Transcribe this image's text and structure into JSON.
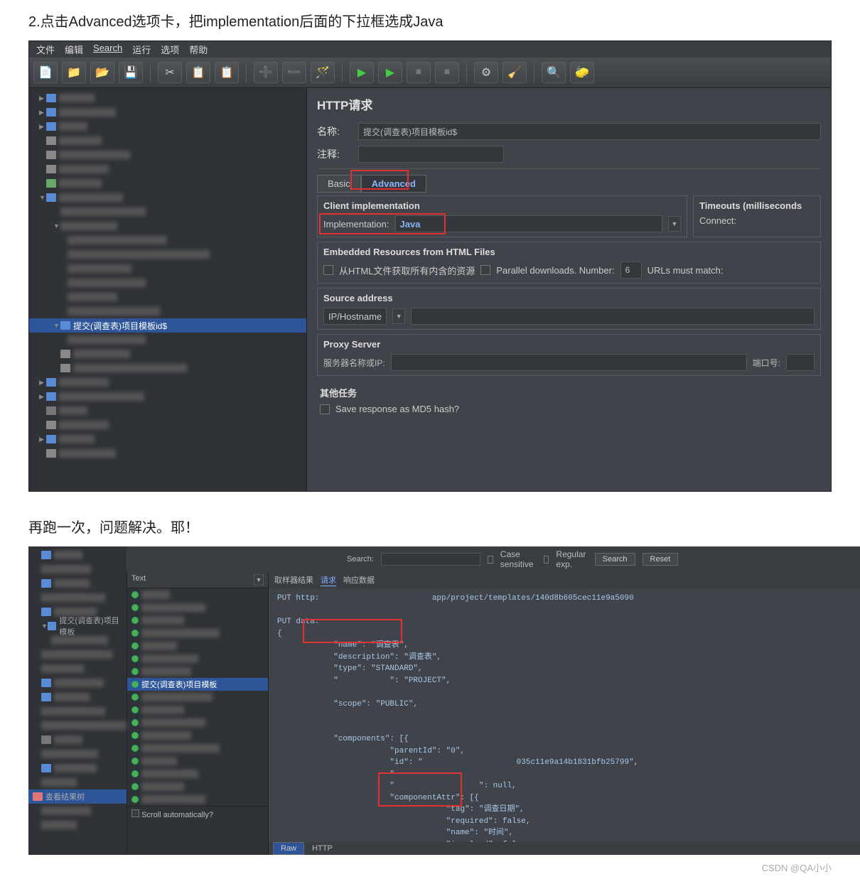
{
  "caption1": "2.点击Advanced选项卡，把implementation后面的下拉框选成Java",
  "caption2": "再跑一次，问题解决。耶！",
  "footer": "CSDN @QA小小",
  "menubar": [
    "文件",
    "编辑",
    "Search",
    "运行",
    "选项",
    "帮助"
  ],
  "toolbar_icons": [
    "📄",
    "📁",
    "📂",
    "💾",
    "✂",
    "📋",
    "📋",
    "➕",
    "➖",
    "🪄",
    "▶",
    "▶",
    "⏹",
    "⏹",
    "⚙",
    "🧹",
    "🔍",
    "🧽"
  ],
  "tree_selected": "提交(调查表)项目模板id$",
  "panel": {
    "title": "HTTP请求",
    "name_label": "名称:",
    "name_value": "提交(调查表)项目模板id$",
    "comment_label": "注释:",
    "tab_basic": "Basic",
    "tab_advanced": "Advanced",
    "client_impl": "Client implementation",
    "impl_label": "Implementation:",
    "impl_value": "Java",
    "timeouts": "Timeouts (milliseconds",
    "connect": "Connect:",
    "embedded": "Embedded Resources from HTML Files",
    "embed_check": "从HTML文件获取所有内含的资源",
    "parallel": "Parallel downloads. Number:",
    "parallel_num": "6",
    "urls_match": "URLs must match:",
    "source": "Source address",
    "iphost": "IP/Hostname",
    "proxy": "Proxy Server",
    "proxy_label": "服务器名称或IP:",
    "port_label": "端口号:",
    "other": "其他任务",
    "save_md5": "Save response as MD5 hash?"
  },
  "app2": {
    "search_label": "Search:",
    "case": "Case sensitive",
    "regex": "Regular exp.",
    "search_btn": "Search",
    "reset_btn": "Reset",
    "text_label": "Text",
    "tree_sel": "提交(调查表)项目模板",
    "mid_sel": "提交(调查表)项目模板",
    "tree_viewer": "查看结果树",
    "tabs": [
      "取样器结果",
      "请求",
      "响应数据"
    ],
    "put_line": "PUT http:                        app/project/templates/140d8b605cec11e9a5090",
    "put_data": "PUT data:",
    "code_lines": [
      "{",
      "            \"name\": \"调查表\",",
      "            \"description\": \"调查表\",",
      "            \"type\": \"STANDARD\",",
      "            \"           \": \"PROJECT\",",
      "",
      "            \"scope\": \"PUBLIC\",",
      "",
      "",
      "            \"components\": [{",
      "                        \"parentId\": \"0\",",
      "                        \"id\": \"                    035c11e9a14b1831bfb25799\",",
      "                        \"",
      "                        \"                  \": null,",
      "                        \"componentAttr\": [{",
      "                                    \"tag\": \"调查日期\",",
      "                                    \"required\": false,",
      "                                    \"name\": \"时间\",",
      "                                    \"involved\": false,"
    ],
    "scroll": "Scroll automatically?",
    "raw": "Raw",
    "http": "HTTP"
  }
}
